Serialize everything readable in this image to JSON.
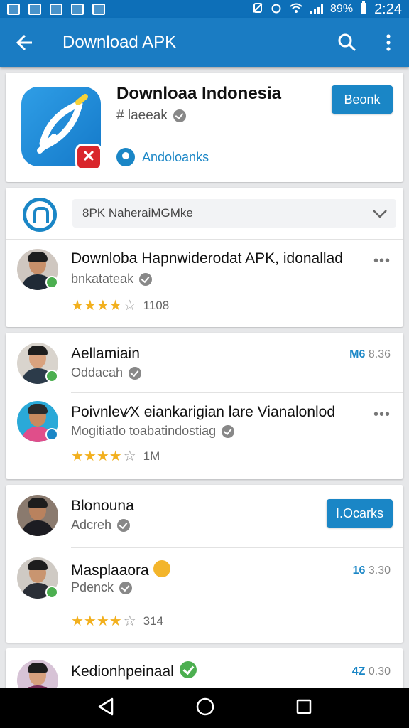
{
  "status_bar": {
    "battery": "89%",
    "time": "2:24"
  },
  "app_bar": {
    "title": "Download APK"
  },
  "hero": {
    "title": "Downloaa Indonesia",
    "subtitle": "# laeeak",
    "link": "Andoloanks",
    "button": "Beonk"
  },
  "filter": {
    "value": "8PK  NaheraiMGMke"
  },
  "items": [
    {
      "title": "Downloba Hapnwiderodat APK, idonallad",
      "subtitle": "bnkatateak",
      "stars": "★★★★",
      "count": "1108"
    },
    {
      "title": "Aellamiain",
      "subtitle": "Oddacah",
      "meta_accent": "M6",
      "meta": "8.36"
    },
    {
      "title": "Poivnlev⁄X eiankarigian lare Vianalonlod",
      "subtitle": "Mogitiatlo toabatindostiag",
      "stars": "★★★★",
      "count": "1M"
    },
    {
      "title": "Blonouna",
      "subtitle": "Adcreh",
      "button": "I.Ocarks"
    },
    {
      "title": "Masplaaora",
      "subtitle": "Pdenck",
      "meta_accent": "16",
      "meta": "3.30",
      "stars": "★★★★",
      "count": "314"
    },
    {
      "title": "Kedionhpeinaal",
      "meta_accent": "4Z",
      "meta": "0.30"
    }
  ],
  "colors": {
    "primary": "#1a7cc3",
    "accent": "#1a86c6",
    "star": "#f2b01e"
  }
}
